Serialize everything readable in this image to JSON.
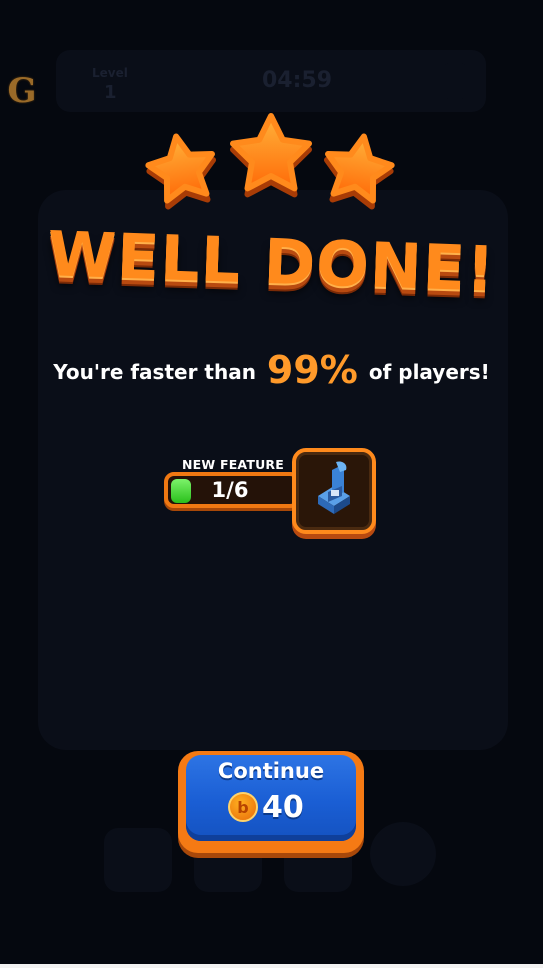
{
  "app": {
    "logo_letter": "G"
  },
  "background_hud": {
    "level_label": "Level",
    "level_value": "1",
    "timer": "04:59"
  },
  "result": {
    "stars_earned": 3,
    "stars_total": 3,
    "title": "WELL DONE!",
    "speed_prefix": "You're faster than",
    "speed_percent": "99%",
    "speed_suffix": "of players!"
  },
  "feature": {
    "label": "NEW FEATURE",
    "progress_text": "1/6",
    "progress_fraction": 0.1667,
    "icon": "sprinkler-icon"
  },
  "continue_button": {
    "label": "Continue",
    "price": "40",
    "coin_icon": "coin-icon",
    "coin_glyph": "b"
  },
  "colors": {
    "accent_orange": "#ff8a1c",
    "button_blue": "#1a5ed4",
    "progress_green": "#2ac01c",
    "background": "#05080f"
  }
}
